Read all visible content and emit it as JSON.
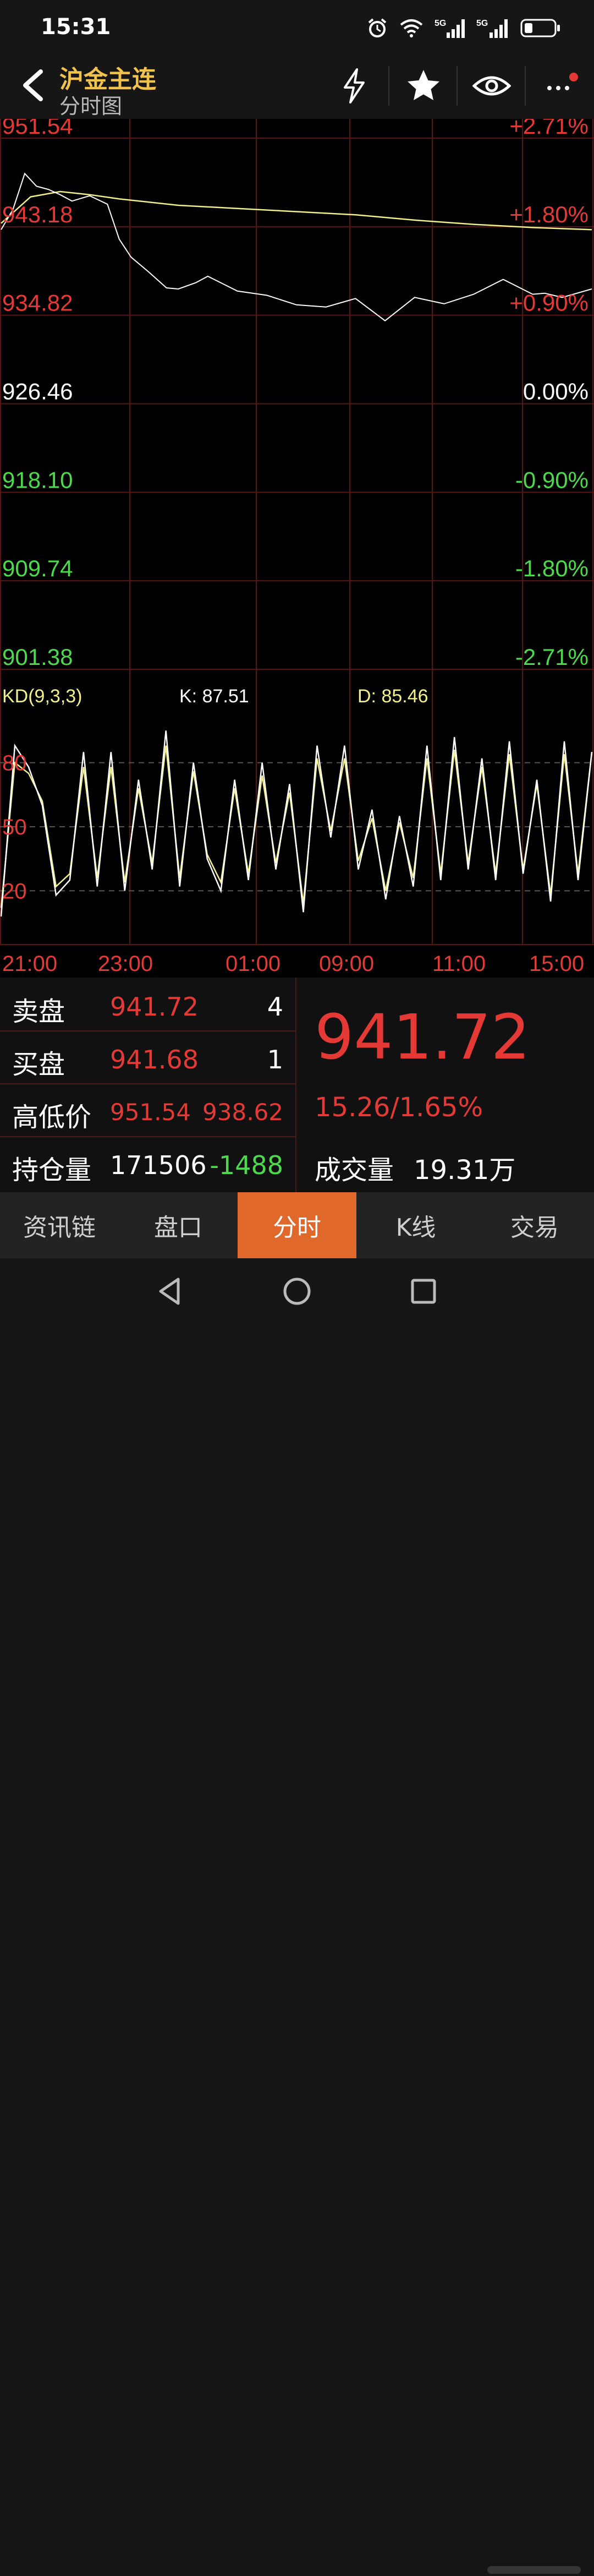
{
  "status_bar": {
    "time": "15:31",
    "net1": "5G",
    "net2": "5G"
  },
  "header": {
    "title": "沪金主连",
    "subtitle": "分时图"
  },
  "icons": {
    "back": "chevron-left-icon",
    "flash": "lightning-icon",
    "favorite": "star-icon",
    "watch": "eye-icon",
    "more": "more-dots-icon",
    "alarm": "alarm-icon",
    "wifi": "wifi-icon",
    "battery": "battery-icon"
  },
  "colors": {
    "up": "#e53935",
    "down": "#4cd94c",
    "neutral": "#ffffff",
    "accent": "#e0682a",
    "title": "#f2c34b",
    "grid": "#5a1414",
    "price_line": "#ffffff",
    "avg_line": "#f2f08a",
    "d_line": "#f2f08a",
    "k_line": "#ffffff"
  },
  "price_axis": [
    {
      "price": "951.54",
      "pct": "+2.71%",
      "dir": "up"
    },
    {
      "price": "943.18",
      "pct": "+1.80%",
      "dir": "up"
    },
    {
      "price": "934.82",
      "pct": "+0.90%",
      "dir": "up"
    },
    {
      "price": "926.46",
      "pct": "0.00%",
      "dir": "flat"
    },
    {
      "price": "918.10",
      "pct": "-0.90%",
      "dir": "down"
    },
    {
      "price": "909.74",
      "pct": "-1.80%",
      "dir": "down"
    },
    {
      "price": "901.38",
      "pct": "-2.71%",
      "dir": "down"
    }
  ],
  "indicator": {
    "name": "KD(9,3,3)",
    "k_label": "K: 87.51",
    "d_label": "D: 85.46",
    "levels": [
      "80",
      "50",
      "20"
    ]
  },
  "time_axis": [
    "21:00",
    "23:00",
    "01:00",
    "09:00",
    "11:00",
    "15:00"
  ],
  "chart_data": {
    "type": "line",
    "ylim": [
      901.38,
      951.54
    ],
    "base_price": 926.46,
    "price_series_x": [
      0,
      2,
      4,
      6,
      8,
      10,
      12,
      15,
      18,
      20,
      22,
      25,
      28,
      30,
      33,
      35,
      40,
      45,
      50,
      55,
      60,
      65,
      70,
      75,
      80,
      85,
      90,
      92,
      95,
      100
    ],
    "price_series": [
      942.9,
      944.8,
      948.2,
      947.0,
      946.7,
      946.2,
      945.6,
      946.1,
      945.3,
      942.0,
      940.3,
      938.9,
      937.4,
      937.3,
      937.9,
      938.5,
      937.1,
      936.7,
      935.8,
      935.6,
      936.4,
      934.3,
      936.5,
      935.9,
      936.8,
      938.2,
      936.8,
      936.9,
      936.5,
      937.3
    ],
    "avg_series_x": [
      0,
      5,
      10,
      15,
      20,
      30,
      40,
      50,
      60,
      70,
      80,
      90,
      100
    ],
    "avg_series": [
      943.5,
      946.0,
      946.5,
      946.2,
      945.8,
      945.2,
      944.9,
      944.6,
      944.3,
      943.8,
      943.4,
      943.1,
      942.9
    ],
    "kd_k": [
      8,
      88,
      78,
      60,
      18,
      25,
      85,
      22,
      85,
      20,
      72,
      30,
      95,
      22,
      80,
      35,
      20,
      72,
      25,
      80,
      30,
      70,
      10,
      88,
      45,
      88,
      30,
      58,
      16,
      55,
      22,
      88,
      25,
      92,
      30,
      82,
      25,
      90,
      28,
      72,
      15,
      90,
      25,
      85
    ],
    "kd_d": [
      12,
      80,
      75,
      62,
      22,
      28,
      78,
      26,
      78,
      24,
      68,
      33,
      88,
      26,
      76,
      37,
      24,
      68,
      28,
      74,
      33,
      66,
      14,
      82,
      48,
      82,
      34,
      54,
      20,
      52,
      26,
      82,
      28,
      86,
      33,
      78,
      28,
      84,
      30,
      70,
      18,
      84,
      28,
      85
    ],
    "kd_ylim": [
      0,
      100
    ]
  },
  "quote": {
    "ask_label": "卖盘",
    "ask_price": "941.72",
    "ask_vol": "4",
    "bid_label": "买盘",
    "bid_price": "941.68",
    "bid_vol": "1",
    "hl_label": "高低价",
    "high": "951.54",
    "low": "938.62",
    "oi_label": "持仓量",
    "oi": "171506",
    "oi_change": "-1488",
    "last_price": "941.72",
    "change": "15.26/1.65%",
    "volume_label": "成交量",
    "volume": "19.31万"
  },
  "tabs": [
    {
      "label": "资讯链",
      "active": false
    },
    {
      "label": "盘口",
      "active": false
    },
    {
      "label": "分时",
      "active": true
    },
    {
      "label": "K线",
      "active": false
    },
    {
      "label": "交易",
      "active": false
    }
  ],
  "system_nav": {
    "back": "triangle-back-icon",
    "home": "circle-home-icon",
    "recents": "square-recents-icon"
  }
}
